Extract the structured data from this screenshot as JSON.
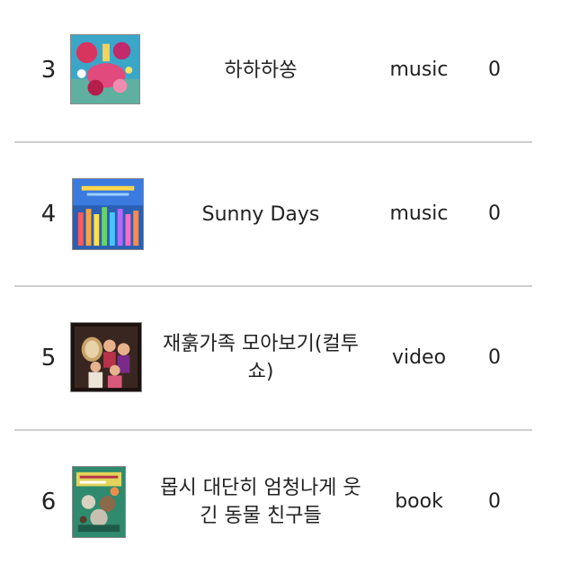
{
  "items": [
    {
      "rank": "3",
      "title": "하하하쏭",
      "type": "music",
      "count": "0",
      "thumb_icon": "album-cover-image"
    },
    {
      "rank": "4",
      "title": "Sunny Days",
      "type": "music",
      "count": "0",
      "thumb_icon": "album-cover-image"
    },
    {
      "rank": "5",
      "title": "재훍가족 모아보기(컬투쇼)",
      "type": "video",
      "count": "0",
      "thumb_icon": "video-thumbnail-image"
    },
    {
      "rank": "6",
      "title": "몹시 대단히 엄청나게 웃긴 동물 친구들",
      "type": "book",
      "count": "0",
      "thumb_icon": "book-cover-image"
    }
  ],
  "colors": {
    "divider": "#cfcfcf",
    "text": "#222222"
  }
}
